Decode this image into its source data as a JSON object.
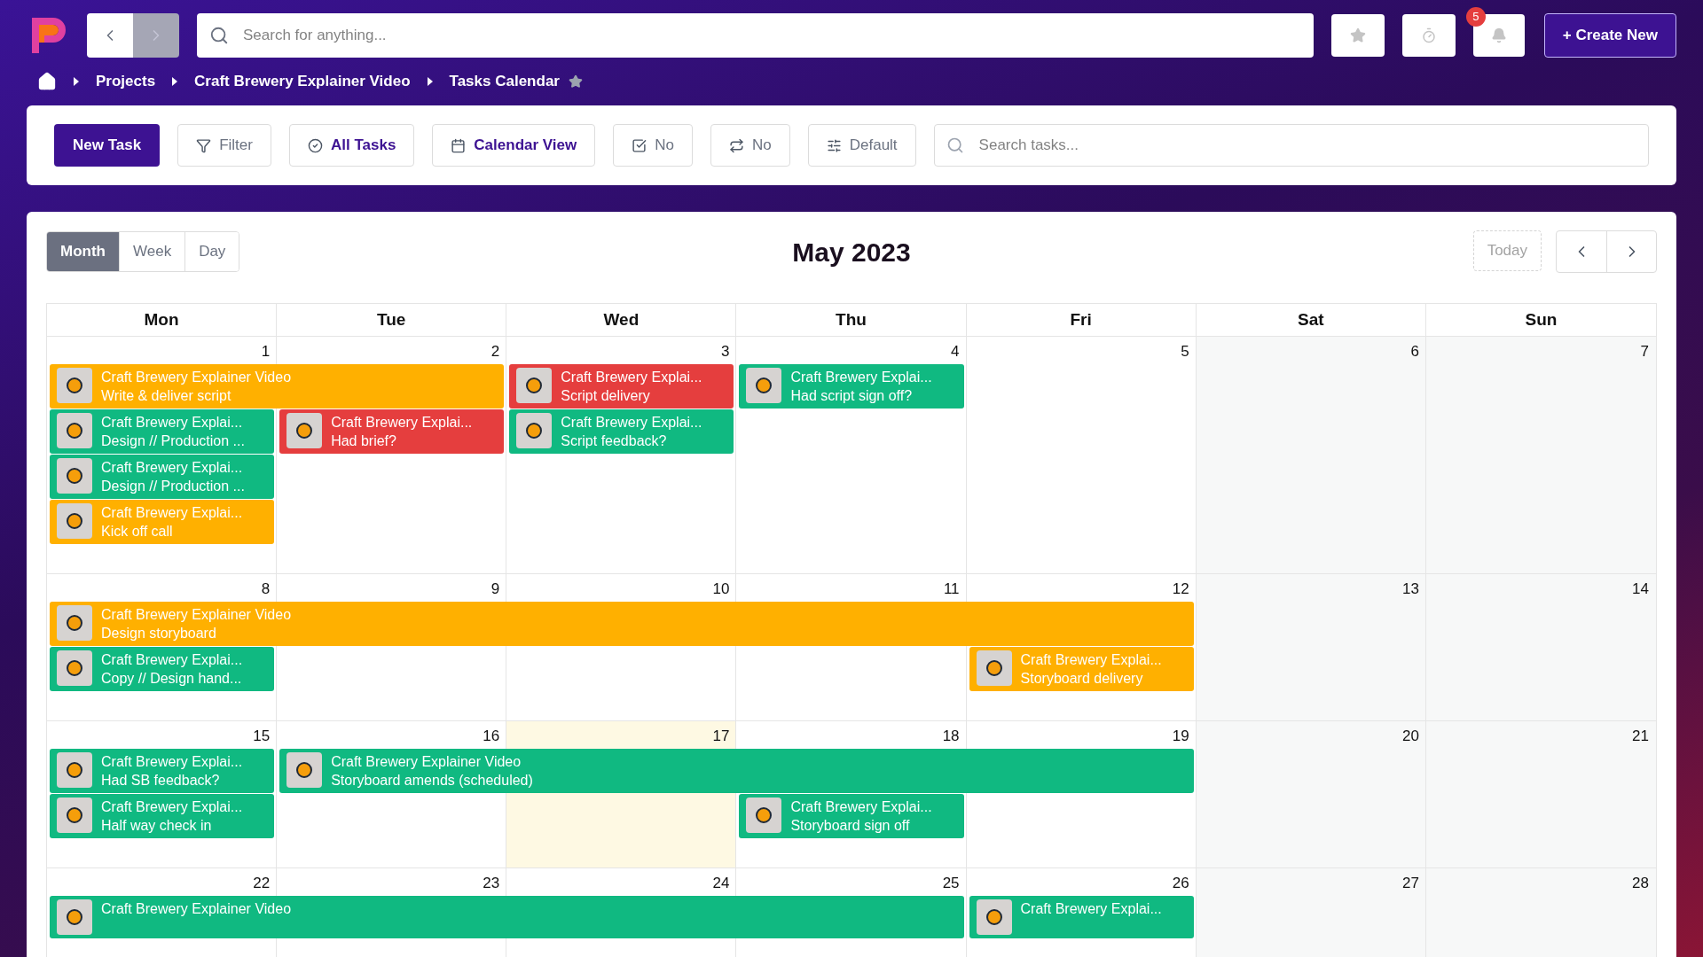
{
  "topbar": {
    "search": {
      "placeholder": "Search for anything..."
    },
    "notifications": {
      "count": "5"
    },
    "create_button": "+ Create New"
  },
  "breadcrumb": {
    "items": [
      "Projects",
      "Craft Brewery Explainer Video",
      "Tasks Calendar"
    ],
    "starred": false
  },
  "toolbar": {
    "new_task": "New Task",
    "buttons": [
      {
        "kind": "filter",
        "label": "Filter",
        "active": false
      },
      {
        "kind": "tasks",
        "label": "All Tasks",
        "active": true
      },
      {
        "kind": "calendar",
        "label": "Calendar View",
        "active": true
      },
      {
        "kind": "checkbox",
        "label": "No",
        "active": false
      },
      {
        "kind": "repeat",
        "label": "No",
        "active": false
      },
      {
        "kind": "sliders",
        "label": "Default",
        "active": false
      }
    ],
    "search": {
      "placeholder": "Search tasks..."
    }
  },
  "calendar": {
    "views": [
      {
        "label": "Month",
        "selected": true
      },
      {
        "label": "Week",
        "selected": false
      },
      {
        "label": "Day",
        "selected": false
      }
    ],
    "title": "May 2023",
    "today_button": {
      "label": "Today",
      "disabled": true
    },
    "weekdays": [
      "Mon",
      "Tue",
      "Wed",
      "Thu",
      "Fri",
      "Sat",
      "Sun"
    ],
    "weeks": [
      {
        "days": [
          {
            "number": "1",
            "today": false,
            "events": [
              {
                "kind": "two_days",
                "title": "Craft Brewery Explainer Video",
                "subtitle": "Write & deliver script",
                "color": "#ffb000"
              },
              {
                "kind": "one_day",
                "title": "Craft Brewery Explai...",
                "subtitle": "Design // Production ...",
                "color": "#10b981"
              },
              {
                "kind": "one_day",
                "title": "Craft Brewery Explai...",
                "subtitle": "Design // Production ...",
                "color": "#10b981"
              },
              {
                "kind": "one_day",
                "title": "Craft Brewery Explai...",
                "subtitle": "Kick off call",
                "color": "#ffb000"
              }
            ]
          },
          {
            "number": "2",
            "today": false,
            "events": [
              {
                "kind": "one_day",
                "title": "Craft Brewery Explai...",
                "subtitle": "Had brief?",
                "color": "#e53e3e"
              }
            ]
          },
          {
            "number": "3",
            "today": false,
            "events": [
              {
                "kind": "one_day",
                "title": "Craft Brewery Explai...",
                "subtitle": "Script delivery",
                "color": "#e53e3e"
              },
              {
                "kind": "one_day",
                "title": "Craft Brewery Explai...",
                "subtitle": "Script feedback?",
                "color": "#10b981"
              }
            ]
          },
          {
            "number": "4",
            "today": false,
            "events": [
              {
                "kind": "one_day",
                "title": "Craft Brewery Explai...",
                "subtitle": "Had script sign off?",
                "color": "#10b981"
              }
            ]
          },
          {
            "number": "5",
            "today": false
          },
          {
            "number": "6",
            "today": false
          },
          {
            "number": "7",
            "today": false
          }
        ]
      },
      {
        "days": [
          {
            "number": "8",
            "today": false,
            "events": [
              {
                "kind": "five_days",
                "title": "Craft Brewery Explainer Video",
                "subtitle": "Design storyboard",
                "color": "#ffb000"
              },
              {
                "kind": "one_day",
                "title": "Craft Brewery Explai...",
                "subtitle": "Copy // Design hand...",
                "color": "#10b981"
              }
            ]
          },
          {
            "number": "9",
            "today": false
          },
          {
            "number": "10",
            "today": false
          },
          {
            "number": "11",
            "today": false
          },
          {
            "number": "12",
            "today": false,
            "events": [
              {
                "kind": "one_day",
                "title": "Craft Brewery Explai...",
                "subtitle": "Storyboard delivery",
                "color": "#ffb000"
              }
            ]
          },
          {
            "number": "13",
            "today": false
          },
          {
            "number": "14",
            "today": false
          }
        ]
      },
      {
        "days": [
          {
            "number": "15",
            "today": false,
            "events": [
              {
                "kind": "one_day",
                "title": "Craft Brewery Explai...",
                "subtitle": "Had SB feedback?",
                "color": "#10b981"
              },
              {
                "kind": "one_day",
                "title": "Craft Brewery Explai...",
                "subtitle": "Half way check in",
                "color": "#10b981"
              }
            ]
          },
          {
            "number": "16",
            "today": false,
            "events": [
              {
                "kind": "four_days",
                "title": "Craft Brewery Explainer Video",
                "subtitle": "Storyboard amends (scheduled)",
                "color": "#10b981"
              }
            ]
          },
          {
            "number": "17",
            "today": true
          },
          {
            "number": "18",
            "today": false,
            "events": [
              {
                "kind": "one_day",
                "title": "Craft Brewery Explai...",
                "subtitle": "Storyboard sign off",
                "color": "#10b981"
              }
            ]
          },
          {
            "number": "19",
            "today": false
          },
          {
            "number": "20",
            "today": false
          },
          {
            "number": "21",
            "today": false
          }
        ]
      },
      {
        "days": [
          {
            "number": "22",
            "today": false,
            "events": [
              {
                "kind": "four_days",
                "title": "Craft Brewery Explainer Video",
                "color": "#10b981"
              }
            ]
          },
          {
            "number": "23",
            "today": false
          },
          {
            "number": "24",
            "today": false
          },
          {
            "number": "25",
            "today": false
          },
          {
            "number": "26",
            "today": false,
            "events": [
              {
                "kind": "one_day",
                "title": "Craft Brewery Explai...",
                "color": "#10b981"
              }
            ]
          },
          {
            "number": "27",
            "today": false
          },
          {
            "number": "28",
            "today": false
          }
        ]
      }
    ]
  }
}
